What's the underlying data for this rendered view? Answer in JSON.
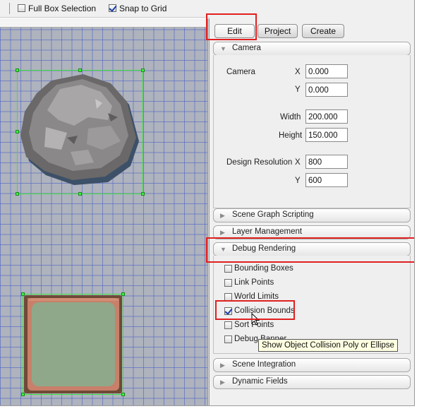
{
  "toolbar": {
    "full_box_selection_label": "Full Box Selection",
    "full_box_selection_checked": false,
    "snap_to_grid_label": "Snap to Grid",
    "snap_to_grid_checked": true
  },
  "tabs": [
    {
      "label": "Edit",
      "active": true
    },
    {
      "label": "Project",
      "active": false
    },
    {
      "label": "Create",
      "active": false
    }
  ],
  "camera_section": {
    "title": "Camera",
    "expanded": true,
    "camera_label": "Camera",
    "x_label": "X",
    "y_label": "Y",
    "camera_x": "0.000",
    "camera_y": "0.000",
    "width_label": "Width",
    "width_value": "200.000",
    "height_label": "Height",
    "height_value": "150.000",
    "design_resolution_label": "Design Resolution",
    "design_x": "800",
    "design_y": "600"
  },
  "sections": {
    "scene_graph_scripting": "Scene Graph Scripting",
    "layer_management": "Layer Management",
    "debug_rendering": "Debug Rendering",
    "scene_integration": "Scene Integration",
    "dynamic_fields": "Dynamic Fields"
  },
  "debug_options": [
    {
      "label": "Bounding Boxes",
      "checked": false
    },
    {
      "label": "Link Points",
      "checked": false
    },
    {
      "label": "World Limits",
      "checked": false
    },
    {
      "label": "Collision Bounds",
      "checked": true
    },
    {
      "label": "Sort Points",
      "checked": false
    },
    {
      "label": "Debug Banner",
      "checked": false
    }
  ],
  "tooltip": "Show Object Collision Poly or Ellipse",
  "colors": {
    "canvas_bg": "#aeb3bd",
    "grid_line": "#4a5ac8",
    "selection": "#3ee03e",
    "highlight_box": "#e02020"
  }
}
